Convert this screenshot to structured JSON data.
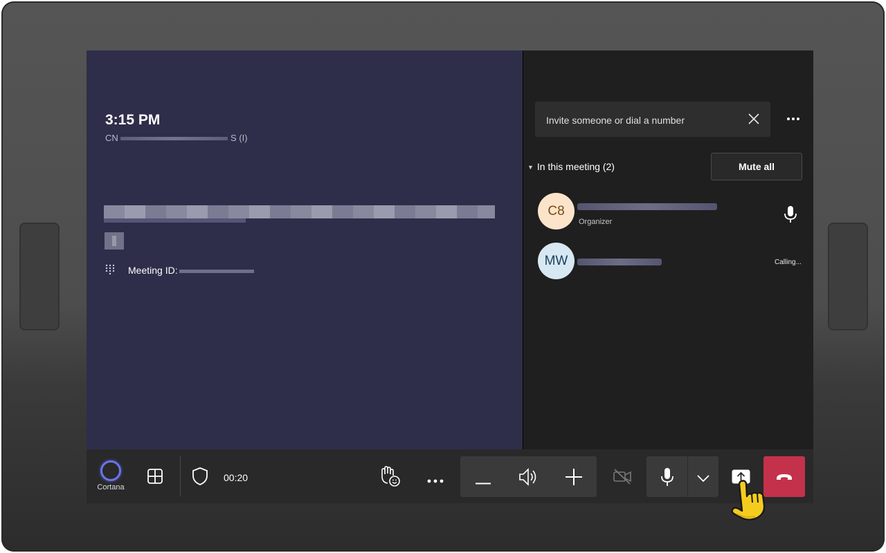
{
  "meeting": {
    "time": "3:15 PM",
    "org_prefix": "CN",
    "org_suffix": "S (I)",
    "meeting_id_label": "Meeting ID:"
  },
  "roster": {
    "invite_placeholder": "Invite someone or dial a number",
    "section_label": "In this meeting (2)",
    "mute_all_label": "Mute all",
    "participants": [
      {
        "initials": "C8",
        "role": "Organizer",
        "status": ""
      },
      {
        "initials": "MW",
        "role": "",
        "status": "Calling..."
      }
    ]
  },
  "toolbar": {
    "cortana_label": "Cortana",
    "call_duration": "00:20"
  },
  "icons": {
    "close": "close-icon",
    "more": "more-options-icon",
    "mic": "microphone-icon",
    "layout": "layout-grid-icon",
    "shield": "shield-icon",
    "reactions": "raise-hand-icon",
    "volume": "speaker-icon",
    "camera": "camera-off-icon",
    "chevron": "chevron-down-icon",
    "share": "share-screen-icon",
    "hangup": "hang-up-icon"
  },
  "colors": {
    "left_pane": "#2e2e4a",
    "right_pane": "#1f1f1f",
    "toolbar": "#292929",
    "hangup": "#c4314b",
    "cortana": "#6c74e8",
    "avatar_c8": "#fce4cb",
    "avatar_mw": "#d7e8f2"
  }
}
